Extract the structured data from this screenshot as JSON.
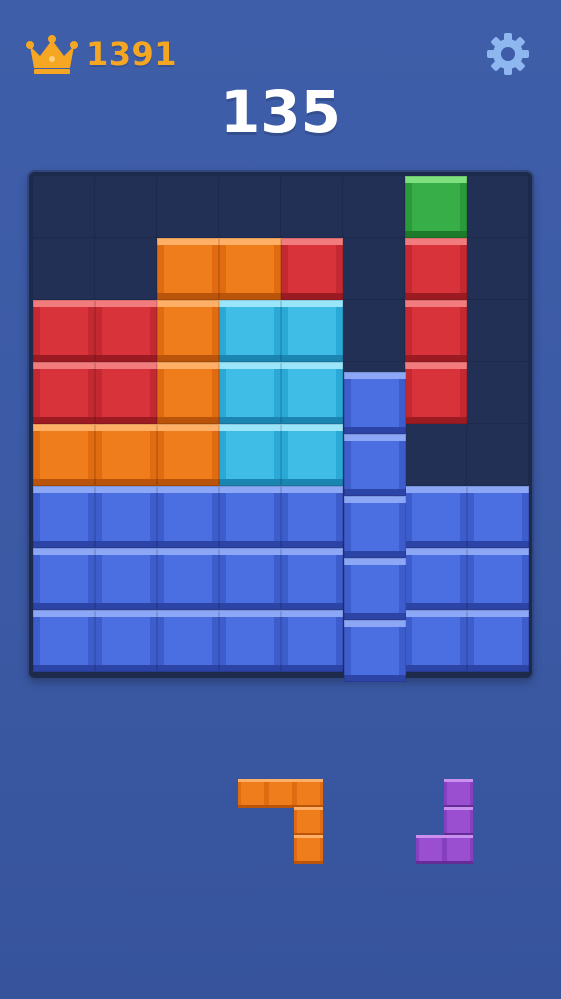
{
  "hud": {
    "best_score": "1391",
    "score": "135",
    "icons": {
      "best": "crown-icon",
      "settings": "gear-icon"
    },
    "colors": {
      "best": "#f5a623",
      "score": "#ffffff",
      "settings": "#8fb7ef"
    }
  },
  "board": {
    "columns": 8,
    "rows": 8,
    "cells": [
      [
        null,
        null,
        null,
        null,
        null,
        null,
        "green",
        null
      ],
      [
        null,
        null,
        "orange",
        "orange",
        "red",
        null,
        "red",
        null
      ],
      [
        "red",
        "red",
        "orange",
        "cyan",
        "cyan",
        null,
        "red",
        null
      ],
      [
        "red",
        "red",
        "orange",
        "cyan",
        "cyan",
        null,
        "red",
        null
      ],
      [
        "orange",
        "orange",
        "orange",
        "cyan",
        "cyan",
        null,
        null,
        null
      ],
      [
        "blue",
        "blue",
        "blue",
        "blue",
        "blue",
        null,
        "blue",
        "blue"
      ],
      [
        "blue",
        "blue",
        "blue",
        "blue",
        "blue",
        null,
        "blue",
        "blue"
      ],
      [
        "blue",
        "blue",
        "blue",
        "blue",
        "blue",
        null,
        "blue",
        "blue"
      ]
    ],
    "dragging_piece": {
      "color": "blue",
      "shape": "vertical-line-5",
      "column": 5,
      "rows": [
        3,
        4,
        5,
        6,
        7
      ]
    }
  },
  "tray": [
    {
      "name": "orange-j-piece",
      "color": "orange",
      "cells": [
        [
          0,
          0
        ],
        [
          1,
          0
        ],
        [
          2,
          0
        ],
        [
          2,
          1
        ],
        [
          2,
          2
        ]
      ]
    },
    {
      "name": "purple-j-piece",
      "color": "purple",
      "cells": [
        [
          1,
          0
        ],
        [
          1,
          1
        ],
        [
          0,
          2
        ],
        [
          1,
          2
        ]
      ]
    }
  ]
}
